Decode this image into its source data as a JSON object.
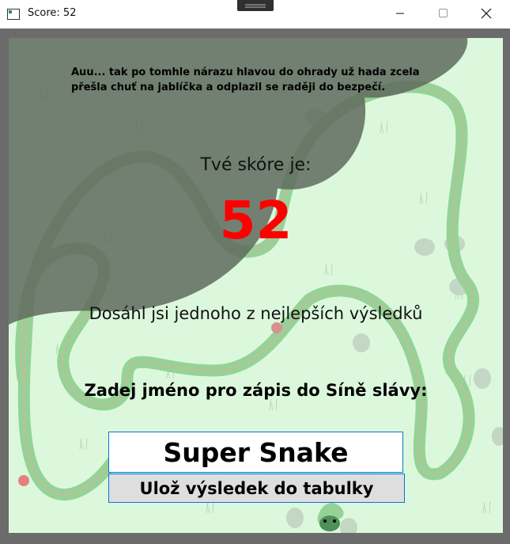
{
  "window": {
    "title": "Score: 52",
    "app_icon": "app-window-icon",
    "controls": [
      "minimize-icon",
      "maximize-icon",
      "close-icon"
    ]
  },
  "game": {
    "crash_message": "Auu... tak po tomhle nárazu hlavou do ohrady už hada zcela přešla chuť na jablíčka a odplazil se raději do bezpečí.",
    "score_label": "Tvé skóre je:",
    "score": "52",
    "high_score_message": "Dosáhl jsi jednoho z nejlepších výsledků",
    "name_prompt": "Zadej jméno pro zápis do Síně slávy:",
    "name_input_value": "Super Snake",
    "save_button_label": "Ulož výsledek do tabulky"
  },
  "colors": {
    "frame": "#6b6b6b",
    "field": "#dcf8dc",
    "snake": "#96d296",
    "overlay": "#5e6b5e",
    "score": "#ff0000",
    "accent_border": "#0078d4",
    "button": "#dedede"
  }
}
